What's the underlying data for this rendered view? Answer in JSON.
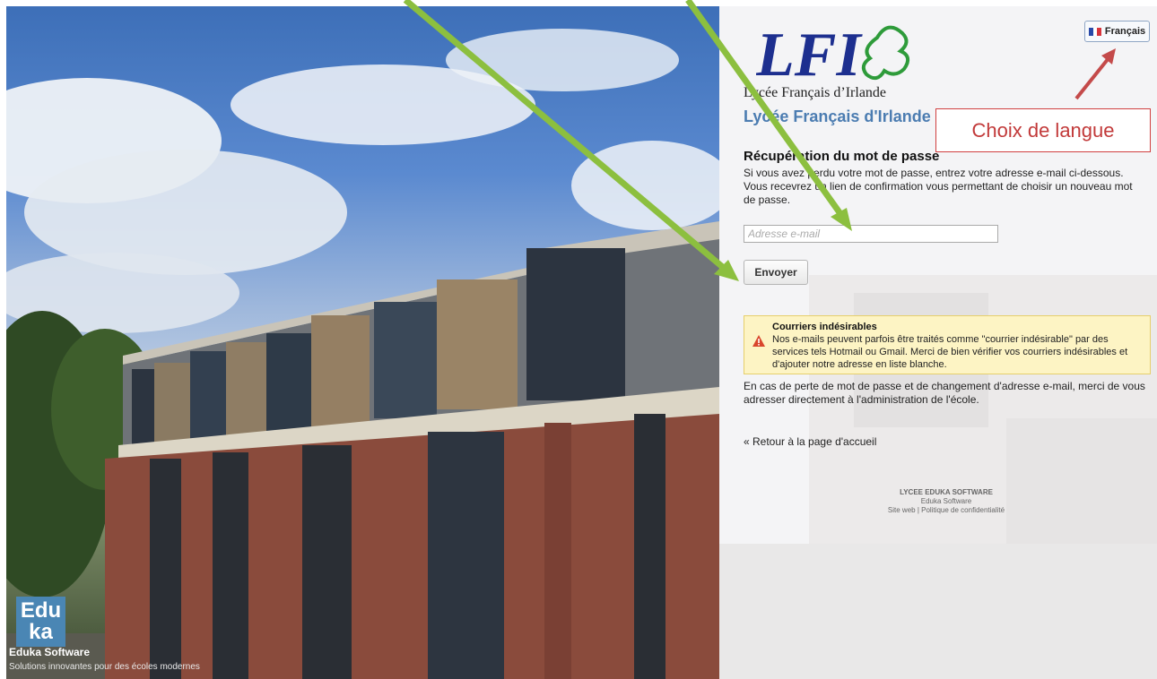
{
  "left_panel": {
    "logo_lines": [
      "Edu",
      "ka"
    ],
    "brand": "Eduka Software",
    "tagline": "Solutions innovantes pour des écoles modernes"
  },
  "header": {
    "logo_letters": "LFI",
    "logo_subtitle": "Lycée Français d’Irlande",
    "school_name": "Lycée Français d'Irlande",
    "language_button": "Français",
    "flag_colors": [
      "#2a4aa8",
      "#ffffff",
      "#d8343c"
    ]
  },
  "annotation": {
    "text": "Choix de langue",
    "arrow_color_red": "#c44a4a",
    "arrow_color_green": "#8cbf3f"
  },
  "form": {
    "title": "Récupération du mot de passe",
    "description": "Si vous avez perdu votre mot de passe, entrez votre adresse e-mail ci-dessous. Vous recevrez un lien de confirmation vous permettant de choisir un nouveau mot de passe.",
    "email_placeholder": "Adresse e-mail",
    "submit_label": "Envoyer"
  },
  "warning": {
    "title": "Courriers indésirables",
    "text": "Nos e-mails peuvent parfois être traités comme \"courrier indésirable\" par des services tels Hotmail ou Gmail. Merci de bien vérifier vos courriers indésirables et d'ajouter notre adresse en liste blanche."
  },
  "note": "En cas de perte de mot de passe et de changement d'adresse e-mail, merci de vous adresser directement à l'administration de l'école.",
  "back_link": "« Retour à la page d'accueil",
  "footer": {
    "line1": "LYCEE EDUKA SOFTWARE",
    "line2": "Eduka Software",
    "site_link": "Site web",
    "separator": "|",
    "privacy_link": "Politique de confidentialité"
  }
}
